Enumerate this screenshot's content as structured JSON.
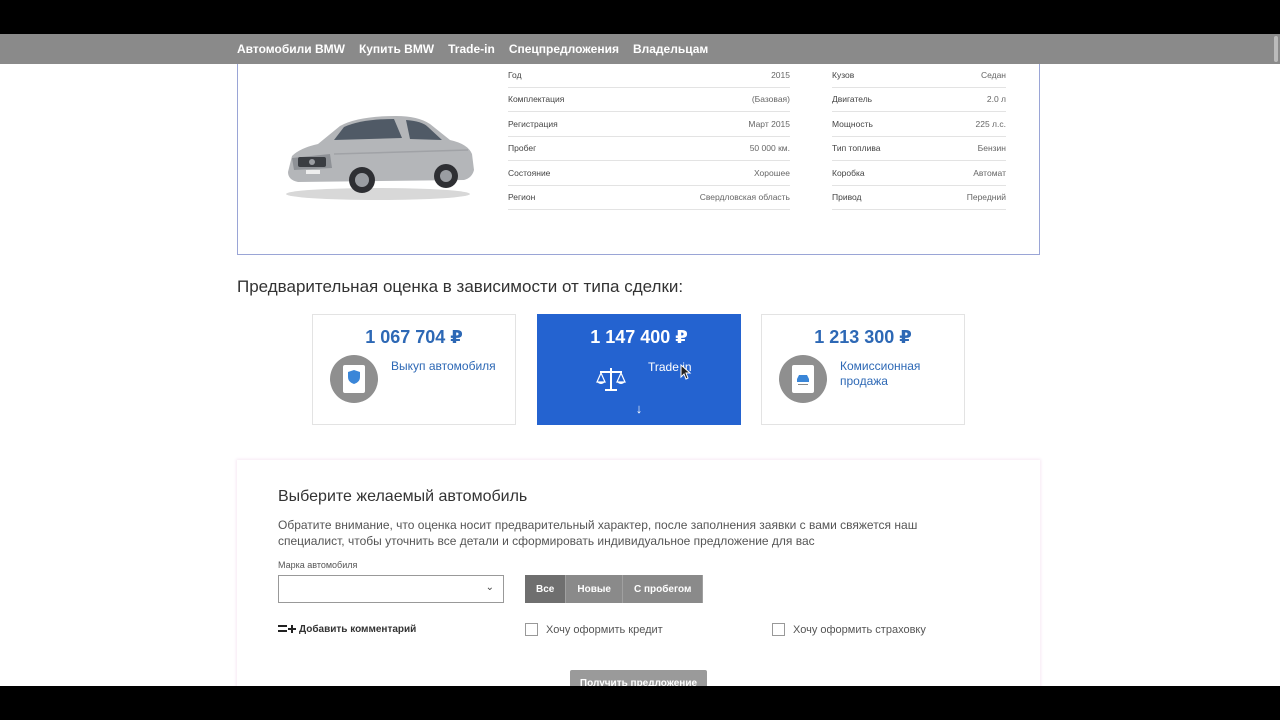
{
  "nav": {
    "items": [
      "Автомобили BMW",
      "Купить BMW",
      "Trade-in",
      "Спецпредложения",
      "Владельцам"
    ]
  },
  "car": {
    "specs_left": [
      {
        "label": "Год",
        "value": "2015"
      },
      {
        "label": "Комплектация",
        "value": "(Базовая)"
      },
      {
        "label": "Регистрация",
        "value": "Март 2015"
      },
      {
        "label": "Пробег",
        "value": "50 000 км."
      },
      {
        "label": "Состояние",
        "value": "Хорошее"
      },
      {
        "label": "Регион",
        "value": "Свердловская область"
      }
    ],
    "specs_right": [
      {
        "label": "Кузов",
        "value": "Седан"
      },
      {
        "label": "Двигатель",
        "value": "2.0 л"
      },
      {
        "label": "Мощность",
        "value": "225 л.с."
      },
      {
        "label": "Тип топлива",
        "value": "Бензин"
      },
      {
        "label": "Коробка",
        "value": "Автомат"
      },
      {
        "label": "Привод",
        "value": "Передний"
      }
    ]
  },
  "estimate": {
    "title": "Предварительная оценка в зависимости от типа сделки:",
    "options": [
      {
        "price": "1 067 704 ₽",
        "label": "Выкуп автомобиля",
        "icon": "document-shield-icon"
      },
      {
        "price": "1 147 400 ₽",
        "label": "Trade in",
        "icon": "scales-icon",
        "arrow": "↓"
      },
      {
        "price": "1 213 300 ₽",
        "label": "Комиссионная продажа",
        "icon": "contract-car-icon"
      }
    ],
    "active_index": 1
  },
  "form": {
    "title": "Выберите желаемый автомобиль",
    "description": "Обратите внимание, что оценка носит предварительный характер, после заполнения заявки с вами свяжется наш специалист, чтобы уточнить все детали и сформировать индивидуальное предложение для вас",
    "brand_label": "Марка автомобиля",
    "brand_value": "",
    "brand_chevron": "⌄",
    "filters": [
      "Все",
      "Новые",
      "С пробегом"
    ],
    "add_comment": "Добавить комментарий",
    "credit_label": "Хочу оформить кредит",
    "insurance_label": "Хочу оформить страховку",
    "submit_label": "Получить предложение"
  },
  "colors": {
    "accent_blue": "#2463d0",
    "price_blue": "#2d68b5",
    "nav_gray": "#8a8a8a"
  }
}
